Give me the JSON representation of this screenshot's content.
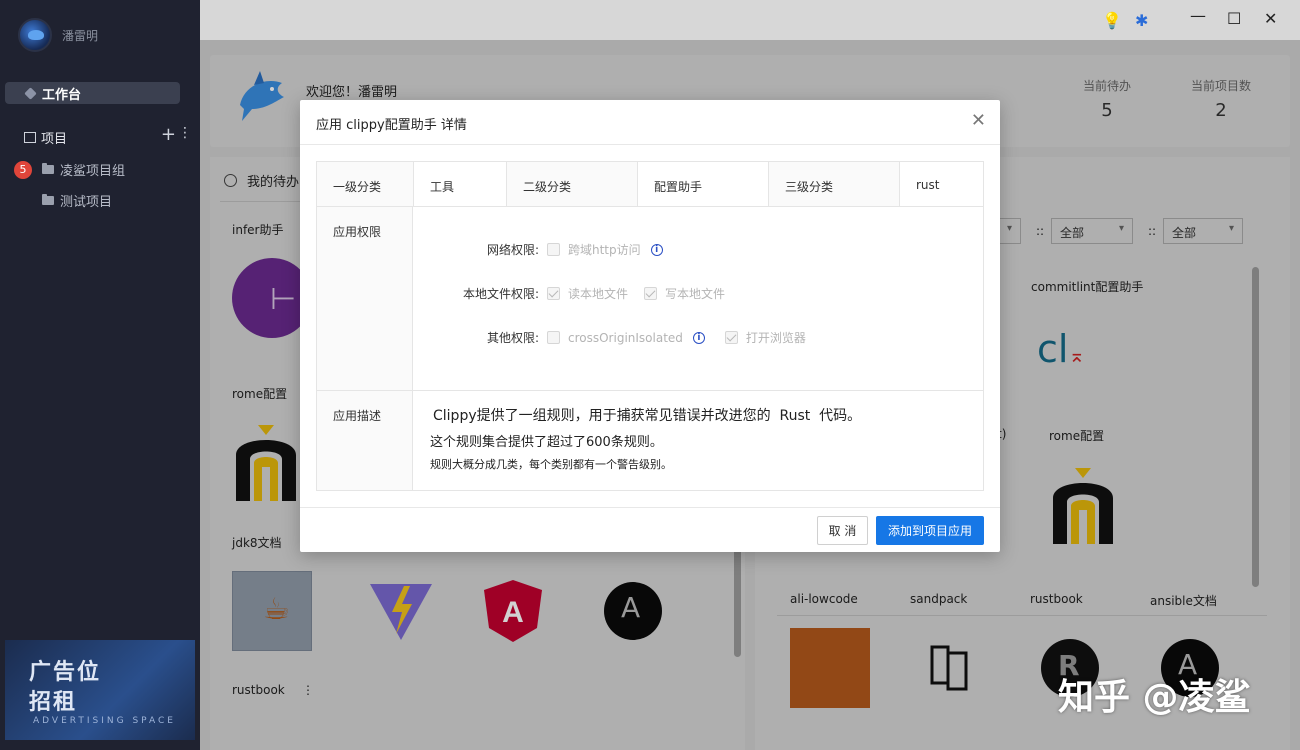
{
  "sidebar": {
    "user_name": "潘雷明",
    "workbench_label": "工作台",
    "projects_label": "项目",
    "project_group_badge": "5",
    "project_group_label": "凌鲨项目组",
    "test_project_label": "测试项目",
    "ad_line1": "广告位",
    "ad_line2": "招租",
    "ad_line3": "ADVERTISING SPACE"
  },
  "header": {
    "welcome_text": "欢迎您！潘雷明",
    "stats": [
      {
        "label": "当前待办",
        "value": "5"
      },
      {
        "label": "当前项目数",
        "value": "2"
      }
    ]
  },
  "todo": {
    "title": "我的待办"
  },
  "apps_left": {
    "labels": [
      "infer助手",
      "rome配置",
      "jdk8文档",
      "rustbook"
    ]
  },
  "apps_right": {
    "filters": [
      "全部",
      "全部"
    ],
    "labels": [
      "commitlint配置助手",
      "t)",
      "rome配置",
      "ali-lowcode",
      "sandpack",
      "rustbook",
      "ansible文档"
    ]
  },
  "modal": {
    "title": "应用 clippy配置助手 详情",
    "row1": {
      "level1_label": "一级分类",
      "level1_value": "工具",
      "level2_label": "二级分类",
      "level2_value": "配置助手",
      "level3_label": "三级分类",
      "level3_value": "rust"
    },
    "permissions_label": "应用权限",
    "permissions": {
      "network_label": "网络权限:",
      "network_cross_http": "跨域http访问",
      "local_file_label": "本地文件权限:",
      "read_local_file": "读本地文件",
      "write_local_file": "写本地文件",
      "other_label": "其他权限:",
      "cross_origin_isolated": "crossOriginIsolated",
      "open_browser": "打开浏览器"
    },
    "description_label": "应用描述",
    "description": {
      "line1": "Clippy提供了一组规则，用于捕获常见错误并改进您的  Rust  代码。",
      "line2": "这个规则集合提供了超过了600条规则。",
      "line3": "规则大概分成几类，每个类别都有一个警告级别。"
    },
    "cancel_label": "取 消",
    "add_label": "添加到项目应用"
  },
  "watermark": "知乎 @凌鲨",
  "colors": {
    "primary": "#1677e6",
    "sidebar_bg": "#1f2230",
    "badge": "#e0453a"
  }
}
